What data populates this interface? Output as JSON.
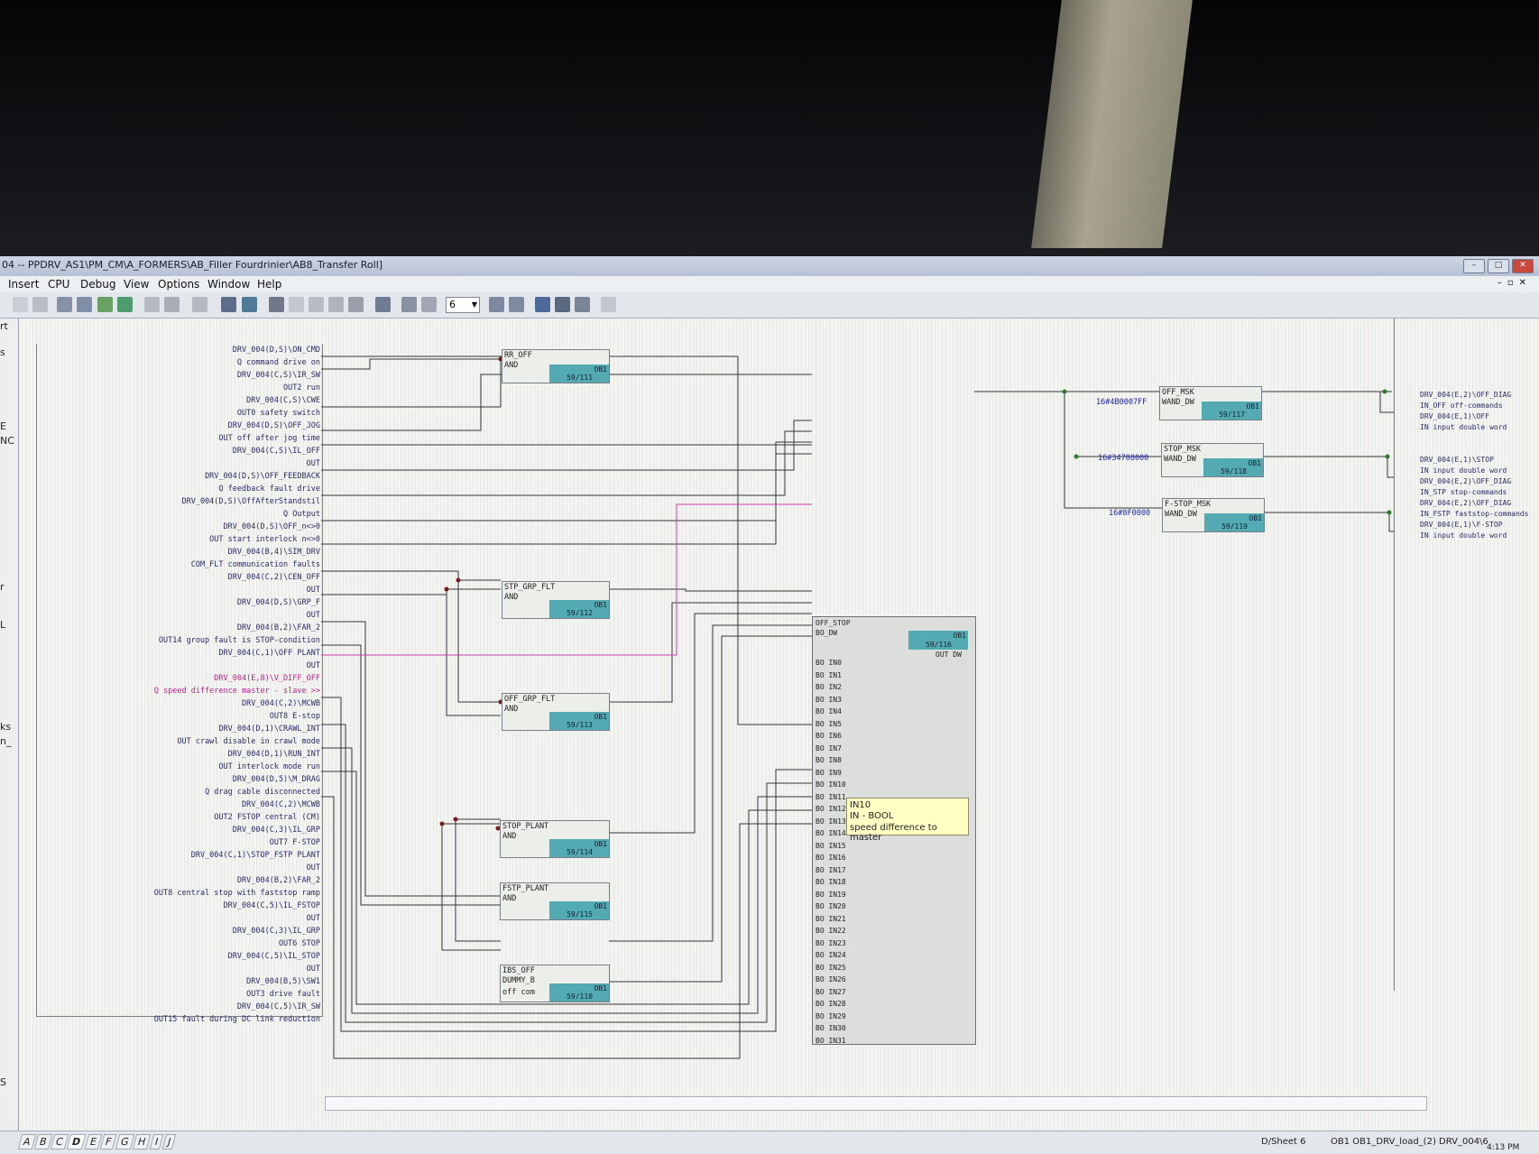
{
  "window": {
    "title": "04 -- PPDRV_AS1\\PM_CM\\A_FORMERS\\AB_Filler Fourdrinier\\AB8_Transfer Roll]"
  },
  "menu": [
    "Insert",
    "CPU",
    "Debug",
    "View",
    "Options",
    "Window",
    "Help"
  ],
  "toolbar": {
    "zoom_value": "6"
  },
  "left_pane": {
    "labels": [
      "rt",
      "s",
      "E",
      "NC",
      "r",
      "L",
      "ks",
      "n_",
      "S"
    ]
  },
  "inputs": [
    "DRV_004(D,S)\\ON_CMD",
    "Q command drive on",
    "DRV_004(C,S)\\IR_SW",
    "OUT2 run",
    "DRV_004(C,S)\\CWE",
    "OUT0 safety switch",
    "DRV_004(D,S)\\OFF_JOG",
    "OUT off after jog time",
    "DRV_004(C,S)\\IL_OFF",
    "OUT",
    "DRV_004(D,S)\\OFF_FEEDBACK",
    "Q feedback fault drive",
    "DRV_004(D,S)\\OffAfterStandstil",
    "Q Output",
    "DRV_004(D,S)\\OFF_n<>0",
    "OUT start interlock n<>0",
    "DRV_004(B,4)\\SIM_DRV",
    "COM_FLT communication faults",
    "DRV_004(C,2)\\CEN_OFF",
    "OUT",
    "DRV_004(D,S)\\GRP_F",
    "OUT",
    "DRV_004(B,2)\\FAR_2",
    "OUT14 group fault is STOP-condition",
    "DRV_004(C,1)\\OFF PLANT",
    "OUT",
    "DRV_004(E,8)\\V_DIFF_OFF",
    "Q speed difference master - slave >>",
    "DRV_004(C,2)\\MCWB",
    "OUT8 E-stop",
    "DRV_004(D,1)\\CRAWL_INT",
    "OUT crawl disable in crawl mode",
    "DRV_004(D,1)\\RUN_INT",
    "OUT interlock mode run",
    "DRV_004(D,5)\\M_DRAG",
    "Q drag cable disconnected",
    "DRV_004(C,2)\\MCWB",
    "OUT2 FSTOP central (CM)",
    "DRV_004(C,3)\\IL_GRP",
    "OUT7 F-STOP",
    "DRV_004(C,1)\\STOP_FSTP PLANT",
    "OUT",
    "DRV_004(B,2)\\FAR_2",
    "OUT8 central stop with faststop ramp",
    "DRV_004(C,5)\\IL_FSTOP",
    "OUT",
    "DRV_004(C,3)\\IL_GRP",
    "OUT6 STOP",
    "DRV_004(C,5)\\IL_STOP",
    "OUT",
    "DRV_004(B,5)\\SW1",
    "OUT3 drive fault",
    "DRV_004(C,5)\\IR_SW",
    "OUT15 fault during DC link reduction"
  ],
  "blocks": [
    {
      "name": "RR_OFF",
      "type": "AND",
      "ob": "OB1",
      "nr": "59/111"
    },
    {
      "name": "STP_GRP_FLT",
      "type": "AND",
      "ob": "OB1",
      "nr": "59/112"
    },
    {
      "name": "OFF_GRP_FLT",
      "type": "AND",
      "ob": "OB1",
      "nr": "59/113"
    },
    {
      "name": "STOP_PLANT",
      "type": "AND",
      "ob": "OB1",
      "nr": "59/114"
    },
    {
      "name": "FSTP_PLANT",
      "type": "AND",
      "ob": "OB1",
      "nr": "59/115"
    },
    {
      "name": "IBS_OFF",
      "type": "DUMMY_B",
      "type2": "off com",
      "ob": "OB1",
      "nr": "59/110"
    },
    {
      "name": "OFF_MSK",
      "type": "WAND_DW",
      "ob": "OB1",
      "nr": "59/117",
      "const": "16#4B0007FF"
    },
    {
      "name": "STOP_MSK",
      "type": "WAND_DW",
      "ob": "OB1",
      "nr": "59/118",
      "const": "16#34708000"
    },
    {
      "name": "F-STOP_MSK",
      "type": "WAND_DW",
      "ob": "OB1",
      "nr": "59/119",
      "const": "16#8F0000"
    }
  ],
  "main_block": {
    "name": "OFF_STOP",
    "type": "BO_DW",
    "ob": "OB1",
    "nr": "59/116",
    "out": "OUT DW",
    "pins": [
      "BO IN0",
      "BO IN1",
      "BO IN2",
      "BO IN3",
      "BO IN4",
      "BO IN5",
      "BO IN6",
      "BO IN7",
      "BO IN8",
      "BO IN9",
      "BO IN10",
      "BO IN11",
      "BO IN12",
      "BO IN13",
      "BO IN14",
      "BO IN15",
      "BO IN16",
      "BO IN17",
      "BO IN18",
      "BO IN19",
      "BO IN20",
      "BO IN21",
      "BO IN22",
      "BO IN23",
      "BO IN24",
      "BO IN25",
      "BO IN26",
      "BO IN27",
      "BO IN28",
      "BO IN29",
      "BO IN30",
      "BO IN31"
    ]
  },
  "tooltip": {
    "line1": "IN10",
    "line2": "IN - BOOL",
    "line3": "speed difference to master"
  },
  "outputs": [
    "DRV_004(E,2)\\OFF_DIAG",
    "IN_OFF off-commands",
    "DRV_004(E,1)\\OFF",
    "IN input double word",
    "DRV_004(E,1)\\STOP",
    "IN input double word",
    "DRV_004(E,2)\\OFF_DIAG",
    "IN_STP stop-commands",
    "DRV_004(E,2)\\OFF_DIAG",
    "IN_FSTP faststop-commands",
    "DRV_004(E,1)\\F-STOP",
    "IN input double word"
  ],
  "status": {
    "tabs": [
      "A",
      "B",
      "C",
      "D",
      "E",
      "F",
      "G",
      "H",
      "I",
      "J"
    ],
    "active_tab": "D",
    "sheet": "D/Sheet 6",
    "location": "OB1 OB1_DRV_load_(2) DRV_004\\6",
    "clock": "4:13 PM"
  }
}
